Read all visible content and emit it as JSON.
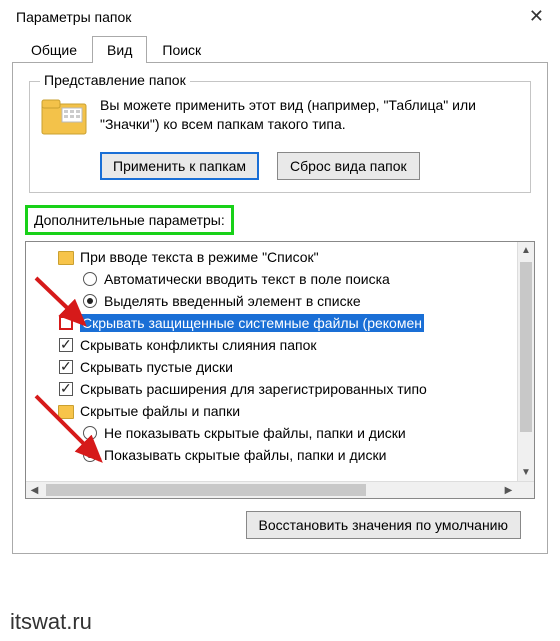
{
  "window": {
    "title": "Параметры папок"
  },
  "tabs": {
    "general": "Общие",
    "view": "Вид",
    "search": "Поиск",
    "active": "view"
  },
  "folderViews": {
    "legend": "Представление папок",
    "desc": "Вы можете применить этот вид (например, \"Таблица\" или \"Значки\") ко всем папкам такого типа.",
    "apply": "Применить к папкам",
    "reset": "Сброс вида папок"
  },
  "advanced": {
    "label": "Дополнительные параметры:",
    "items": [
      {
        "kind": "folder",
        "label": "При вводе текста в режиме \"Список\""
      },
      {
        "kind": "radio",
        "checked": false,
        "label": "Автоматически вводить текст в поле поиска",
        "level": 2
      },
      {
        "kind": "radio",
        "checked": true,
        "label": "Выделять введенный элемент в списке",
        "level": 2
      },
      {
        "kind": "check",
        "checked": false,
        "highlight": true,
        "selected": true,
        "label": "Скрывать защищенные системные файлы (рекомен"
      },
      {
        "kind": "check",
        "checked": true,
        "label": "Скрывать конфликты слияния папок"
      },
      {
        "kind": "check",
        "checked": true,
        "label": "Скрывать пустые диски"
      },
      {
        "kind": "check",
        "checked": true,
        "label": "Скрывать расширения для зарегистрированных типо"
      },
      {
        "kind": "folder",
        "label": "Скрытые файлы и папки"
      },
      {
        "kind": "radio",
        "checked": false,
        "label": "Не показывать скрытые файлы, папки и диски",
        "level": 2
      },
      {
        "kind": "radio",
        "checked": true,
        "label": "Показывать скрытые файлы, папки и диски",
        "level": 2
      }
    ]
  },
  "restoreDefaults": "Восстановить значения по умолчанию",
  "watermark": "itswat.ru"
}
